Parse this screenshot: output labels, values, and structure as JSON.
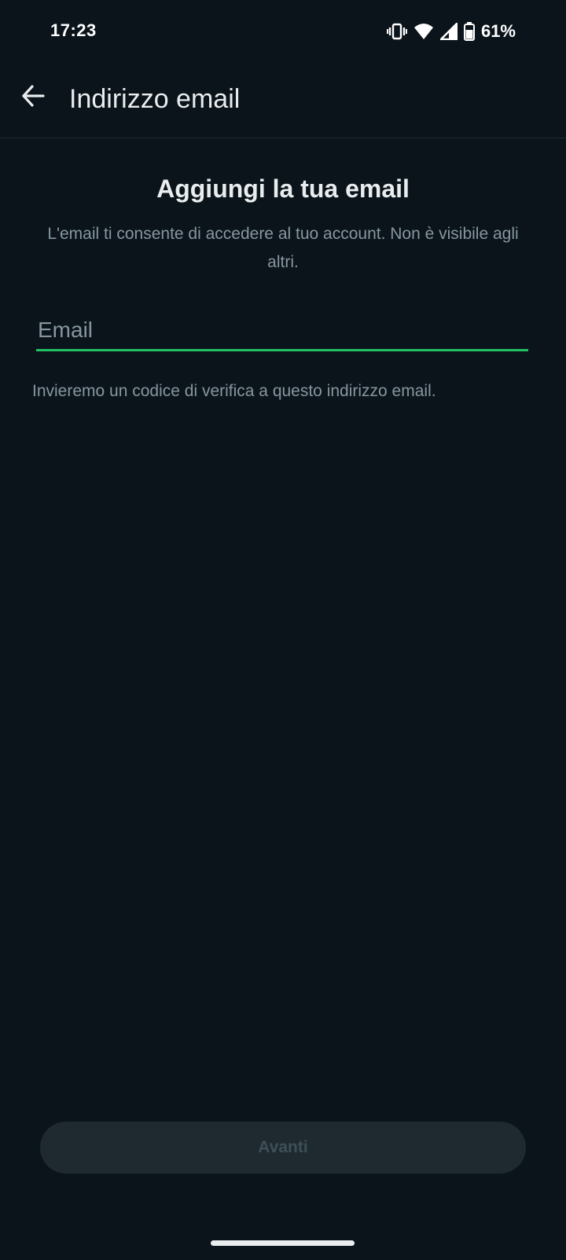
{
  "status_bar": {
    "time": "17:23",
    "battery_percent": "61%",
    "icons": [
      "vibrate-icon",
      "wifi-icon",
      "signal-icon",
      "battery-icon"
    ]
  },
  "app_bar": {
    "title": "Indirizzo email",
    "back_icon": "arrow-back-icon"
  },
  "main": {
    "heading": "Aggiungi la tua email",
    "subtitle": "L'email ti consente di accedere al tuo account. Non è visibile agli altri.",
    "email_input": {
      "placeholder": "Email",
      "value": ""
    },
    "helper_text": "Invieremo un codice di verifica a questo indirizzo email."
  },
  "footer": {
    "next_label": "Avanti"
  },
  "colors": {
    "background": "#0b141a",
    "accent": "#21c063",
    "text_primary": "#e9edef",
    "text_secondary": "#8696a0",
    "button_disabled_bg": "#1e2a30",
    "button_disabled_text": "#3f4f57"
  }
}
